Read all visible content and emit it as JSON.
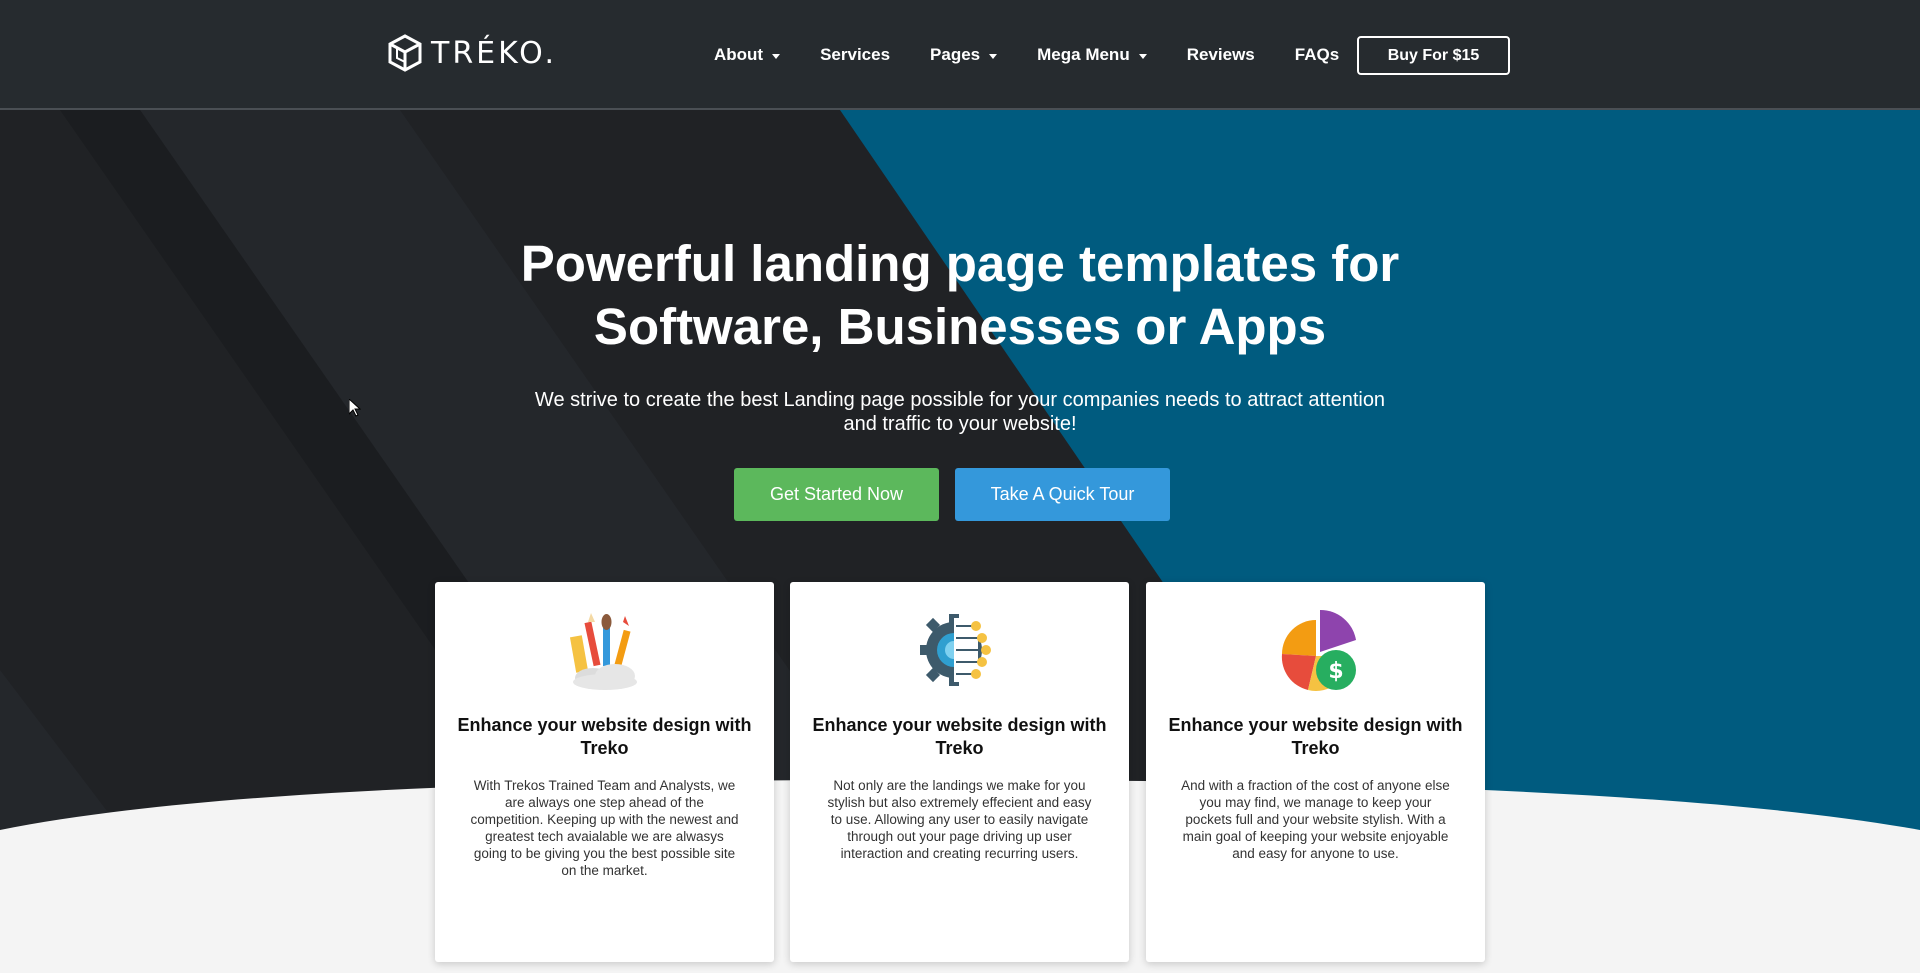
{
  "nav": {
    "logo_text": "TRÉKO.",
    "items": [
      {
        "label": "About",
        "has_dropdown": true
      },
      {
        "label": "Services",
        "has_dropdown": false
      },
      {
        "label": "Pages",
        "has_dropdown": true
      },
      {
        "label": "Mega Menu",
        "has_dropdown": true
      },
      {
        "label": "Reviews",
        "has_dropdown": false
      },
      {
        "label": "FAQs",
        "has_dropdown": false
      }
    ],
    "buy_label": "Buy For $15"
  },
  "hero": {
    "title_line1": "Powerful landing page templates for",
    "title_line2": "Software, Businesses or Apps",
    "subtitle": "We strive to create the best Landing page possible for your companies needs to attract attention and traffic to your website!",
    "primary_cta": "Get Started Now",
    "secondary_cta": "Take A Quick Tour"
  },
  "cards": [
    {
      "icon": "design-tools-icon",
      "title": "Enhance your website design with Treko",
      "text": "With Trekos Trained Team and Analysts, we are always one step ahead of the competition. Keeping up with the newest and greatest tech avaialable we are alwasys going to be giving you the best possible site on the market."
    },
    {
      "icon": "gear-network-icon",
      "title": "Enhance your website design with Treko",
      "text": "Not only are the landings we make for you stylish but also extremely effecient and easy to use. Allowing any user to easily navigate through out your page driving up user interaction and creating recurring users."
    },
    {
      "icon": "pie-chart-dollar-icon",
      "title": "Enhance your website design with Treko",
      "text": "And with a fraction of the cost of anyone else you may find, we manage to keep your pockets full and your website stylish. With a main goal of keeping your website enjoyable and easy for anyone to use."
    }
  ],
  "colors": {
    "nav_bg": "#262b2f",
    "hero_dark": "#202225",
    "hero_teal": "#005b7f",
    "primary_green": "#5cb85c",
    "secondary_blue": "#3498db",
    "footer_light": "#f4f4f4"
  }
}
